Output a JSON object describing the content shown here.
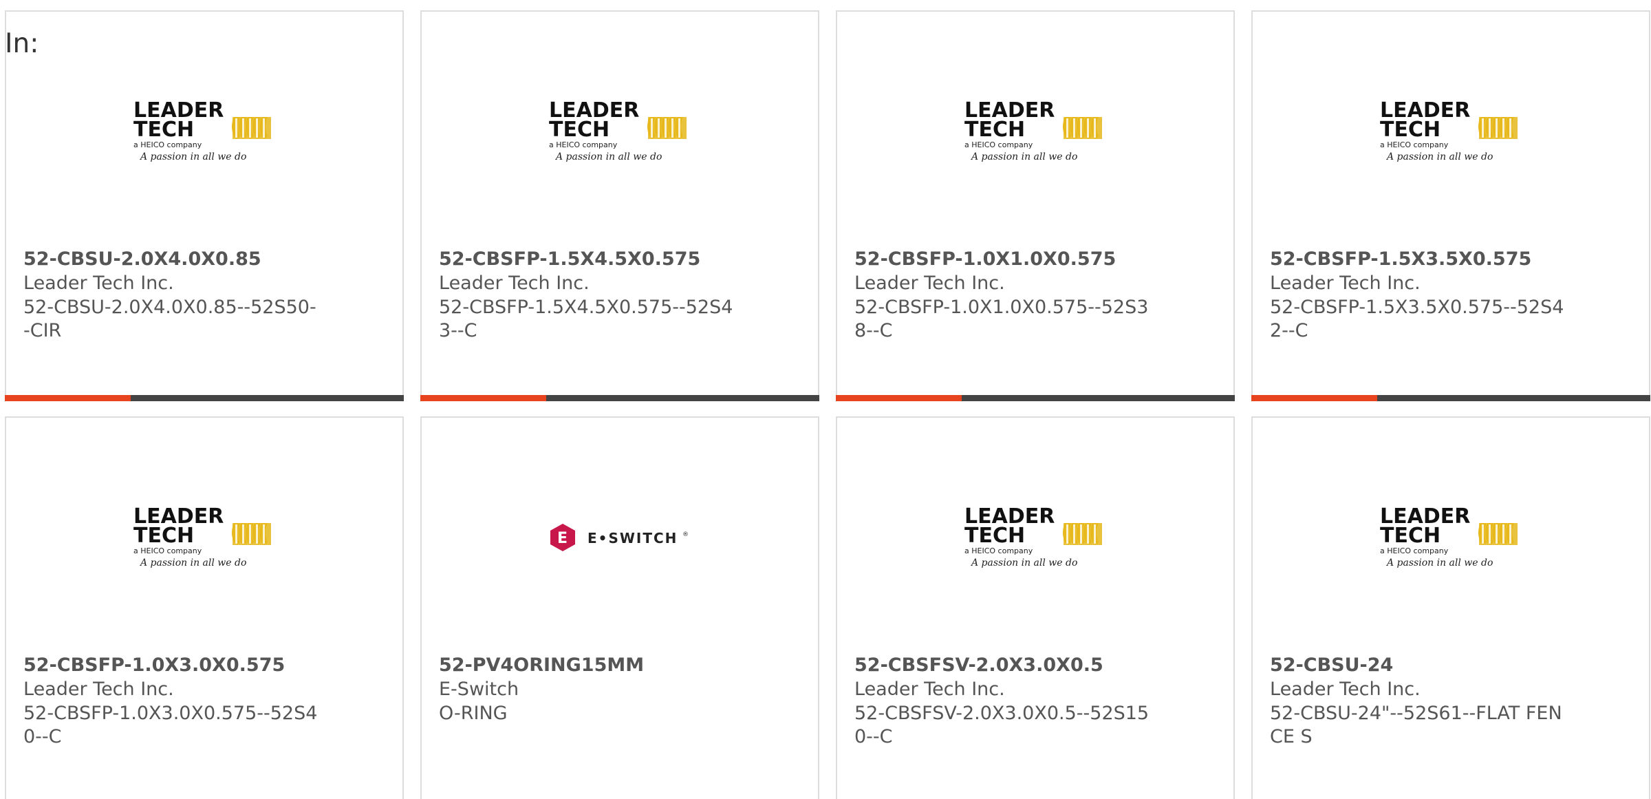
{
  "filter_label": "In:",
  "colors": {
    "accent": "#e8431f",
    "bar": "#444444",
    "text": "#555555",
    "leader_yellow": "#e6b81c",
    "eswitch_red": "#c8174b"
  },
  "products": [
    {
      "part_number": "52-CBSU-2.0X4.0X0.85",
      "manufacturer": "Leader Tech Inc.",
      "description": "52-CBSU-2.0X4.0X0.85--52S50--CIR",
      "logo": "leader-tech-logo"
    },
    {
      "part_number": "52-CBSFP-1.5X4.5X0.575",
      "manufacturer": "Leader Tech Inc.",
      "description": "52-CBSFP-1.5X4.5X0.575--52S43--C",
      "logo": "leader-tech-logo"
    },
    {
      "part_number": "52-CBSFP-1.0X1.0X0.575",
      "manufacturer": "Leader Tech Inc.",
      "description": "52-CBSFP-1.0X1.0X0.575--52S38--C",
      "logo": "leader-tech-logo"
    },
    {
      "part_number": "52-CBSFP-1.5X3.5X0.575",
      "manufacturer": "Leader Tech Inc.",
      "description": "52-CBSFP-1.5X3.5X0.575--52S42--C",
      "logo": "leader-tech-logo"
    },
    {
      "part_number": "52-CBSFP-1.0X3.0X0.575",
      "manufacturer": "Leader Tech Inc.",
      "description": "52-CBSFP-1.0X3.0X0.575--52S40--C",
      "logo": "leader-tech-logo"
    },
    {
      "part_number": "52-PV4ORING15MM",
      "manufacturer": "E-Switch",
      "description": "O-RING",
      "logo": "e-switch-logo"
    },
    {
      "part_number": "52-CBSFSV-2.0X3.0X0.5",
      "manufacturer": "Leader Tech Inc.",
      "description": "52-CBSFSV-2.0X3.0X0.5--52S150--C",
      "logo": "leader-tech-logo"
    },
    {
      "part_number": "52-CBSU-24",
      "manufacturer": "Leader Tech Inc.",
      "description": "52-CBSU-24\"--52S61--FLAT FENCE S",
      "logo": "leader-tech-logo"
    }
  ],
  "leader_logo": {
    "line1": "LEADER",
    "line2": "TECH",
    "tagline": "a HEICO company",
    "script": "A passion in all we do"
  },
  "eswitch_logo": {
    "text": "E•SWITCH",
    "mark": "®"
  }
}
